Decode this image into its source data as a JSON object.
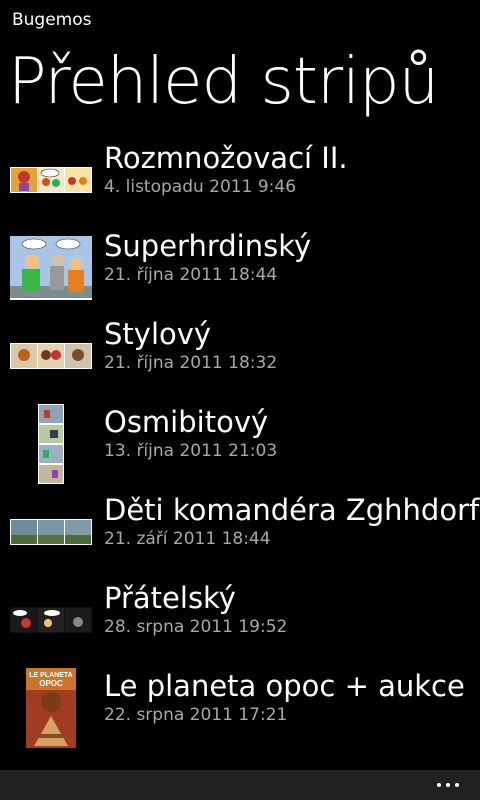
{
  "app": {
    "name": "Bugemos"
  },
  "page": {
    "title": "Přehled stripů"
  },
  "items": [
    {
      "title": "Rozmnožovací II.",
      "date": "4. listopadu 2011 9:46",
      "thumb": "three-panel-strip"
    },
    {
      "title": "Superhrdinský",
      "date": "21. října 2011 18:44",
      "thumb": "single-panel"
    },
    {
      "title": "Stylový",
      "date": "21. října 2011 18:32",
      "thumb": "three-panel-strip"
    },
    {
      "title": "Osmibitový",
      "date": "13. října 2011 21:03",
      "thumb": "vertical-strip"
    },
    {
      "title": "Děti komandéra Zghhdorfa",
      "date": "21. září 2011 18:44",
      "thumb": "three-panel-strip"
    },
    {
      "title": "Přátelský",
      "date": "28. srpna 2011 19:52",
      "thumb": "three-panel-strip"
    },
    {
      "title": "Le planeta opoc + aukce",
      "date": "22. srpna 2011 17:21",
      "thumb": "poster"
    }
  ],
  "poster_text": [
    "LE PLANETA",
    "OPOC"
  ],
  "colors": {
    "background": "#000000",
    "text": "#ffffff",
    "subtle": "#a8a8a8",
    "appbar": "#212121"
  },
  "appbar": {
    "more_icon": "ellipsis-icon"
  }
}
